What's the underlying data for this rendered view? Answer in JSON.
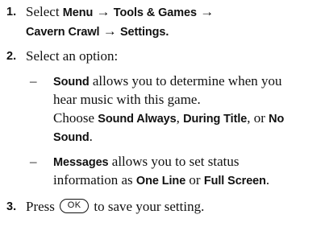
{
  "steps": [
    {
      "number": "1.",
      "line1": {
        "pre": "Select ",
        "menu": "Menu",
        "arrow1": " → ",
        "tools": "Tools & Games",
        "arrow2": " →"
      },
      "line2": {
        "game": "Cavern Crawl",
        "arrow": " → ",
        "settings": "Settings",
        "end": "."
      }
    },
    {
      "number": "2.",
      "text": "Select an option:"
    },
    {
      "number": "3.",
      "pre": "Press ",
      "key": "OK",
      "post": " to save your setting."
    }
  ],
  "options": [
    {
      "dash": "–",
      "name": "Sound",
      "desc1": " allows you to determine when you",
      "desc2": "hear music with this game.",
      "choose": "Choose ",
      "c1": "Sound Always",
      "sep1": ", ",
      "c2": "During Title",
      "sep2": ", or ",
      "c3": "No",
      "c3b": "Sound",
      "end": "."
    },
    {
      "dash": "–",
      "name": "Messages",
      "desc1": " allows you to set status",
      "desc2": "information as ",
      "c1": "One Line",
      "or": " or ",
      "c2": "Full Screen",
      "end": "."
    }
  ]
}
